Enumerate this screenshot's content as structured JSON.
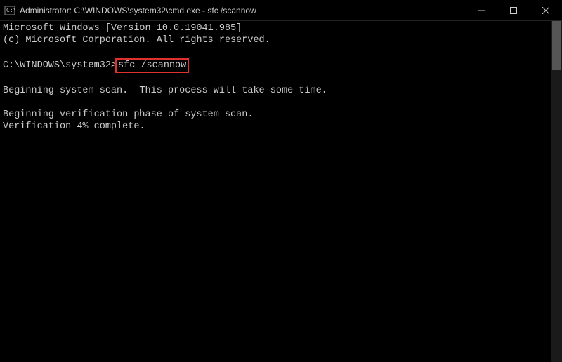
{
  "titlebar": {
    "title": "Administrator: C:\\WINDOWS\\system32\\cmd.exe - sfc  /scannow"
  },
  "terminal": {
    "line1": "Microsoft Windows [Version 10.0.19041.985]",
    "line2": "(c) Microsoft Corporation. All rights reserved.",
    "prompt": "C:\\WINDOWS\\system32>",
    "command": "sfc /scannow",
    "line3": "Beginning system scan.  This process will take some time.",
    "line4": "Beginning verification phase of system scan.",
    "line5": "Verification 4% complete."
  }
}
